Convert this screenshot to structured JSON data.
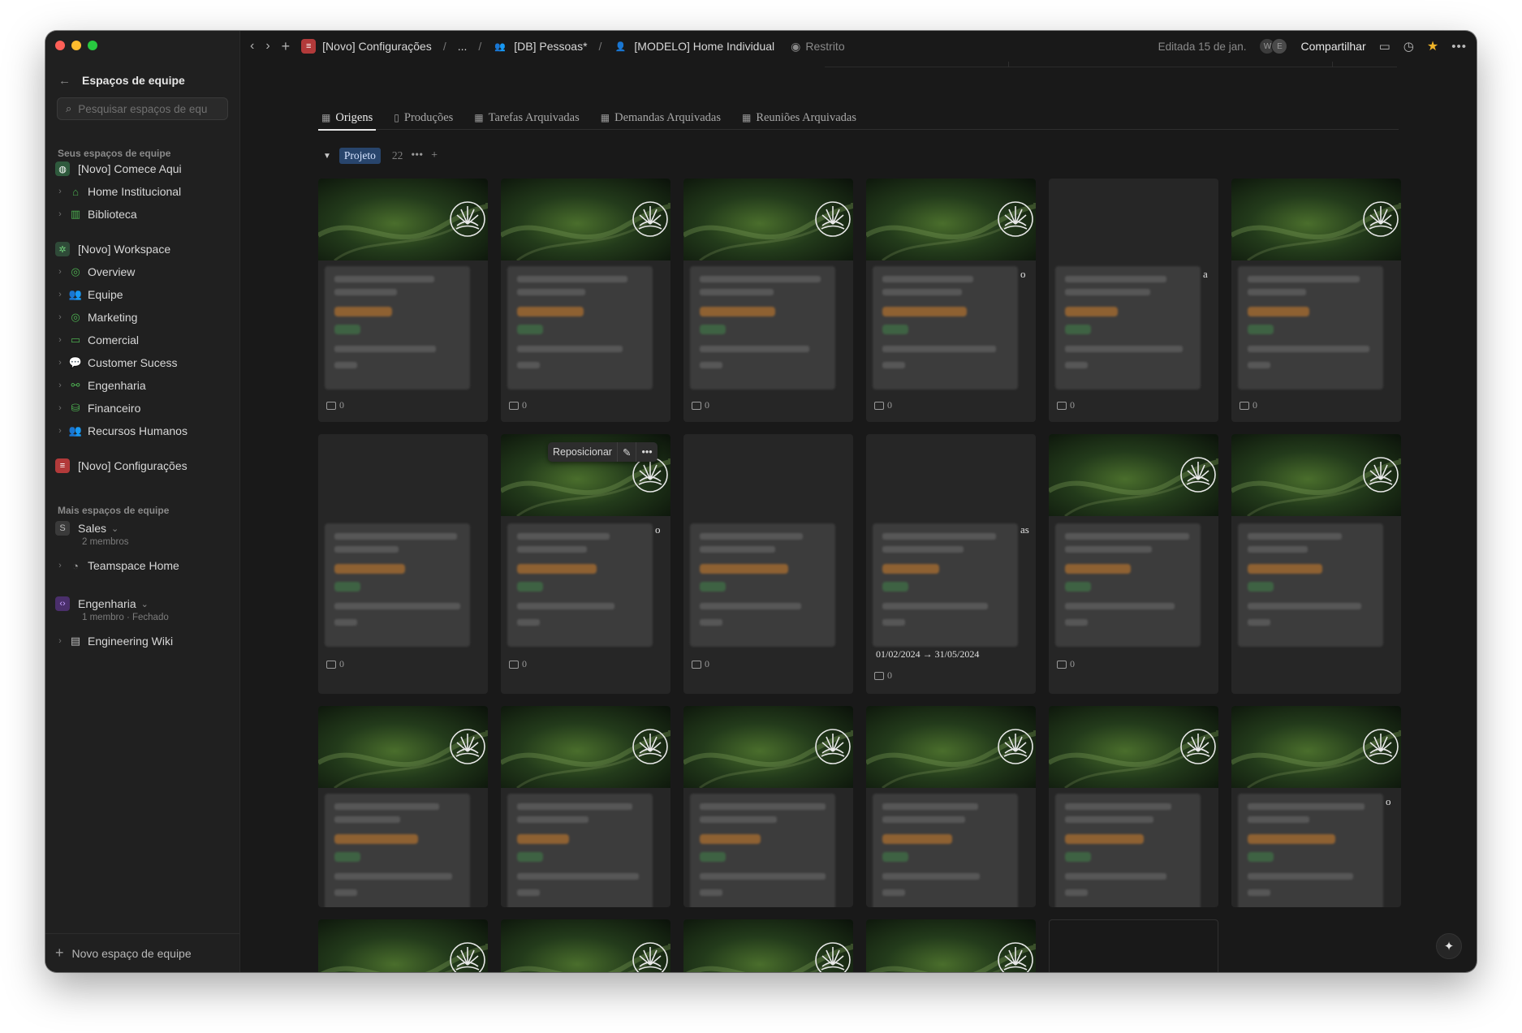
{
  "sidebar": {
    "back_icon": "arrow-left-icon",
    "title": "Espaços de equipe",
    "search_placeholder": "Pesquisar espaços de equipe",
    "section_mine": "Seus espaços de equipe",
    "items_top": [
      {
        "label": "[Novo] Comece Aqui",
        "icon": "globe-icon"
      },
      {
        "label": "Home Institucional",
        "icon": "house-icon"
      },
      {
        "label": "Biblioteca",
        "icon": "book-icon"
      }
    ],
    "workspace": {
      "label": "[Novo] Workspace",
      "icon": "gear-icon"
    },
    "workspace_items": [
      {
        "label": "Overview",
        "icon": "target-icon"
      },
      {
        "label": "Equipe",
        "icon": "people-icon"
      },
      {
        "label": "Marketing",
        "icon": "target-icon"
      },
      {
        "label": "Comercial",
        "icon": "monitor-icon"
      },
      {
        "label": "Customer Sucess",
        "icon": "chat-icon"
      },
      {
        "label": "Engenharia",
        "icon": "nodes-icon"
      },
      {
        "label": "Financeiro",
        "icon": "coins-icon"
      },
      {
        "label": "Recursos Humanos",
        "icon": "people-icon"
      }
    ],
    "config": {
      "label": "[Novo] Configurações",
      "icon": "list-icon"
    },
    "section_more": "Mais espaços de equipe",
    "sales": {
      "label": "Sales",
      "initial": "S",
      "members": "2 membros"
    },
    "teamspace_home": "Teamspace Home",
    "engenharia": {
      "label": "Engenharia",
      "members": "1 membro · Fechado"
    },
    "engineering_wiki": "Engineering Wiki",
    "new_space": "Novo espaço de equipe"
  },
  "topbar": {
    "crumbs": [
      "[Novo] Configurações",
      "...",
      "[DB] Pessoas*",
      "[MODELO] Home Individual"
    ],
    "restricted": "Restrito",
    "edited": "Editada 15 de jan.",
    "avatars": [
      "W",
      "E"
    ],
    "share": "Compartilhar"
  },
  "tabs": [
    "Origens",
    "Produções",
    "Tarefas Arquivadas",
    "Demandas Arquivadas",
    "Reuniões Arquivadas"
  ],
  "group": {
    "label": "Projeto",
    "count": "22"
  },
  "reposition": {
    "label": "Reposicionar"
  },
  "card_texts": {
    "comment_count": "0",
    "date_range": "01/02/2024 → 31/05/2024",
    "edge_o": "o",
    "edge_a": "a",
    "edge_as": "as"
  },
  "colors": {
    "accent_tag": "#28456c",
    "pill_orange": "#b0702e",
    "pill_green": "#3f6b45",
    "pill_blue": "#3a5a93",
    "star": "#f0b429"
  }
}
